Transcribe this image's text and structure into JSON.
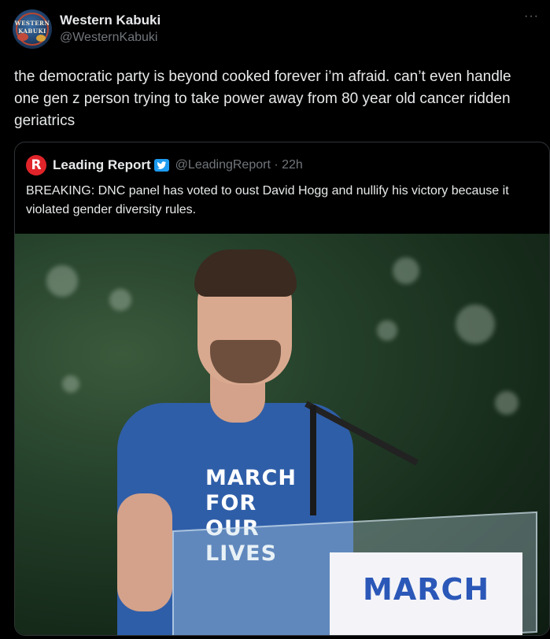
{
  "author": {
    "display_name": "Western Kabuki",
    "handle": "@WesternKabuki",
    "avatar_text": "WESTERN KABUKI"
  },
  "more_label": "···",
  "tweet": {
    "text": "the democratic party is beyond cooked forever i’m afraid.  can’t even handle one gen z person trying to take power away from 80 year old cancer ridden geriatrics"
  },
  "quoted": {
    "logo_letter": "R",
    "display_name": "Leading Report",
    "handle_time": "@LeadingReport · 22h",
    "text": "BREAKING: DNC panel has voted to oust David Hogg and nullify his victory because it violated gender diversity rules.",
    "image": {
      "shirt_text": "MARCH FOR OUR LIVES",
      "sign_text": "MARCH"
    }
  },
  "colors": {
    "background": "#000000",
    "text_primary": "#e7e9ea",
    "text_secondary": "#71767b",
    "border": "#2f3336",
    "verified_badge": "#1d9bf0",
    "leading_report_red": "#e0242a"
  }
}
